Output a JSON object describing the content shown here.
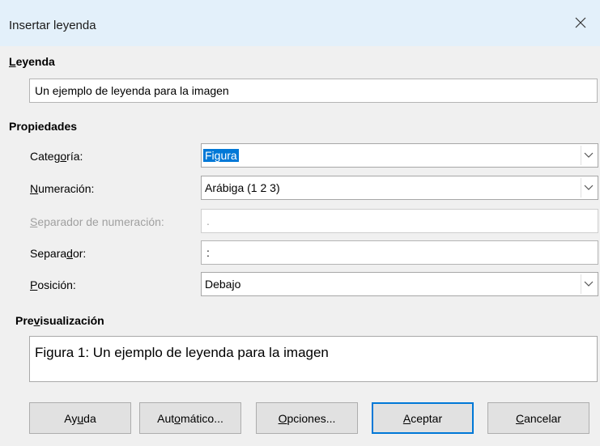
{
  "dialog": {
    "title": "Insertar leyenda",
    "close_icon": "close-icon"
  },
  "caption": {
    "section_label_u": "L",
    "section_label_rest": "eyenda",
    "value": "Un ejemplo de leyenda para la imagen"
  },
  "properties": {
    "section_label": "Propiedades",
    "category": {
      "label_pre": "Categ",
      "label_u": "o",
      "label_post": "ría:",
      "value": "Figura"
    },
    "numbering": {
      "label_u": "N",
      "label_post": "umeración:",
      "value": "Arábiga (1 2 3)"
    },
    "numbering_separator": {
      "label_u": "S",
      "label_post": "eparador de numeración:",
      "value": "."
    },
    "separator": {
      "label_pre": "Separa",
      "label_u": "d",
      "label_post": "or:",
      "value": ":"
    },
    "position": {
      "label_u": "P",
      "label_post": "osición:",
      "value": "Debajo"
    }
  },
  "preview": {
    "label_pre": "Pre",
    "label_u": "v",
    "label_post": "isualización",
    "text": "Figura 1: Un ejemplo de leyenda para la imagen"
  },
  "buttons": {
    "help": {
      "pre": "Ay",
      "u": "u",
      "post": "da"
    },
    "auto": {
      "pre": "Aut",
      "u": "o",
      "post": "mático..."
    },
    "options": {
      "pre": "",
      "u": "O",
      "post": "pciones..."
    },
    "ok": {
      "pre": "",
      "u": "A",
      "post": "ceptar"
    },
    "cancel": {
      "pre": "",
      "u": "C",
      "post": "ancelar"
    }
  },
  "colors": {
    "titlebar": "#e3f0fa",
    "accent": "#0078d7",
    "background": "#f0f0f0"
  }
}
